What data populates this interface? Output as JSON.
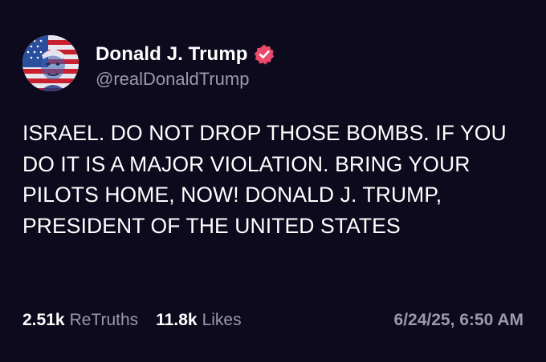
{
  "post": {
    "author": {
      "display_name": "Donald J. Trump",
      "handle": "@realDonaldTrump",
      "verified": true,
      "avatar_icon": "flag-portrait-avatar",
      "verified_icon": "verified-badge-icon",
      "verified_color": "#ea4b6a"
    },
    "text": "ISRAEL. DO NOT DROP THOSE BOMBS. IF YOU DO IT IS A MAJOR VIOLATION. BRING YOUR PILOTS HOME, NOW! DONALD J. TRUMP, PRESIDENT OF THE UNITED STATES",
    "stats": {
      "retruths_count": "2.51k",
      "retruths_label": "ReTruths",
      "likes_count": "11.8k",
      "likes_label": "Likes"
    },
    "timestamp": "6/24/25, 6:50 AM"
  },
  "colors": {
    "background": "#0c0a1c",
    "primary_text": "#ffffff",
    "secondary_text": "#9a9aad"
  }
}
